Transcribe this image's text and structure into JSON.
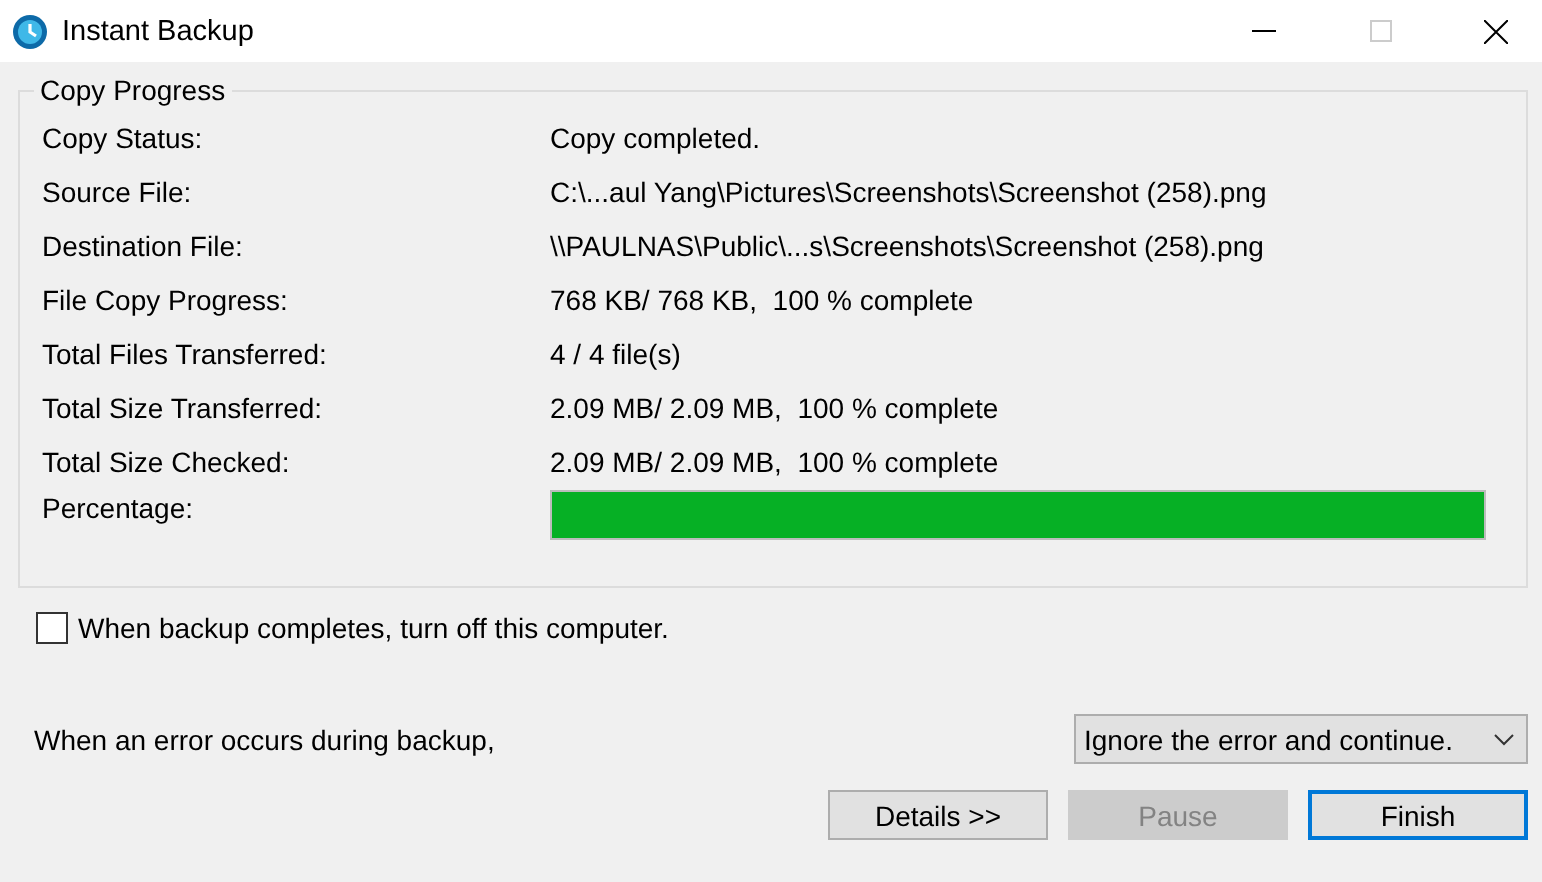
{
  "window": {
    "title": "Instant Backup",
    "maximize_disabled": true
  },
  "group": {
    "title": "Copy Progress",
    "rows": [
      {
        "label": "Copy Status:",
        "value": "Copy completed."
      },
      {
        "label": "Source File:",
        "value": "C:\\...aul Yang\\Pictures\\Screenshots\\Screenshot (258).png"
      },
      {
        "label": "Destination File:",
        "value": "\\\\PAULNAS\\Public\\...s\\Screenshots\\Screenshot (258).png"
      },
      {
        "label": "File Copy Progress:",
        "value": "768 KB/ 768 KB,  100 % complete"
      },
      {
        "label": "Total Files Transferred:",
        "value": "4 / 4 file(s)"
      },
      {
        "label": "Total Size Transferred:",
        "value": "2.09 MB/ 2.09 MB,  100 % complete"
      },
      {
        "label": "Total Size Checked:",
        "value": "2.09 MB/ 2.09 MB,  100 % complete"
      }
    ],
    "percentage": {
      "label": "Percentage:",
      "level": 1
    }
  },
  "shutdown_option": {
    "label": "When backup completes, turn off this computer.",
    "checked": false
  },
  "error_option": {
    "label": "When an error occurs during backup,",
    "value": "Ignore the error and continue."
  },
  "buttons": [
    {
      "label": "Details >>",
      "disabled": false,
      "default": false
    },
    {
      "label": "Pause",
      "disabled": true,
      "default": false
    },
    {
      "label": "Finish",
      "disabled": false,
      "default": true
    }
  ]
}
